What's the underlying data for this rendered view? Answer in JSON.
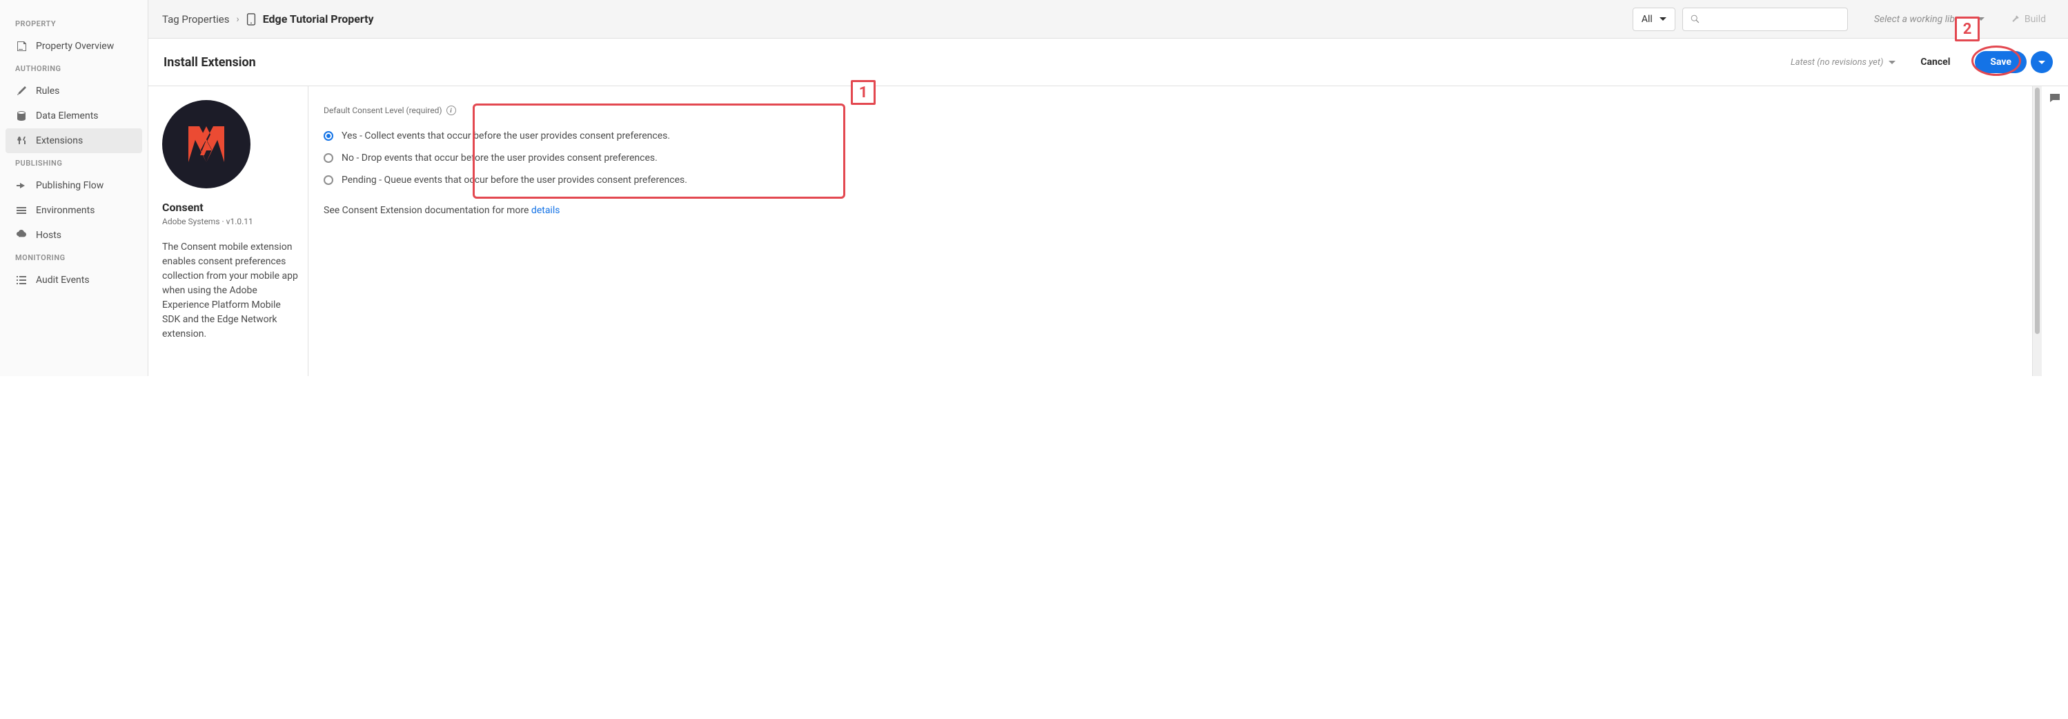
{
  "sidebar": {
    "sections": {
      "property": "PROPERTY",
      "authoring": "AUTHORING",
      "publishing": "PUBLISHING",
      "monitoring": "MONITORING"
    },
    "items": {
      "overview": "Property Overview",
      "rules": "Rules",
      "dataElements": "Data Elements",
      "extensions": "Extensions",
      "publishingFlow": "Publishing Flow",
      "environments": "Environments",
      "hosts": "Hosts",
      "auditEvents": "Audit Events"
    }
  },
  "topbar": {
    "breadcrumb_root": "Tag Properties",
    "breadcrumb_current": "Edge Tutorial Property",
    "filter_label": "All",
    "library_placeholder": "Select a working library",
    "build_label": "Build"
  },
  "pagebar": {
    "title": "Install Extension",
    "revision_label": "Latest (no revisions yet)",
    "cancel": "Cancel",
    "save": "Save"
  },
  "extension": {
    "name": "Consent",
    "vendor": "Adobe Systems",
    "version": "v1.0.11",
    "description": "The Consent mobile extension enables consent preferences collection from your mobile app when using the Adobe Experience Platform Mobile SDK and the Edge Network extension."
  },
  "config": {
    "field_label": "Default Consent Level (required)",
    "options": {
      "yes": "Yes - Collect events that occur before the user provides consent preferences.",
      "no": "No - Drop events that occur before the user provides consent preferences.",
      "pending": "Pending - Queue events that occur before the user provides consent preferences."
    },
    "doc_prefix": "See Consent Extension documentation for more ",
    "doc_link": "details"
  },
  "callouts": {
    "one": "1",
    "two": "2"
  }
}
